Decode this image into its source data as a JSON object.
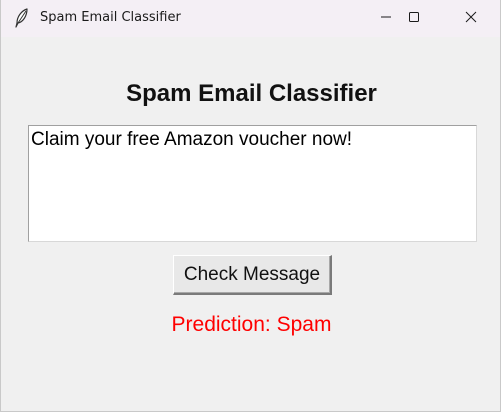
{
  "window": {
    "title": "Spam Email Classifier",
    "icons": {
      "app": "feather-icon",
      "minimize": "minimize-icon",
      "maximize": "maximize-icon",
      "close": "close-icon"
    }
  },
  "main": {
    "heading": "Spam Email Classifier",
    "message_text": "Claim your free Amazon voucher now!",
    "check_button_label": "Check Message",
    "prediction_text": "Prediction: Spam"
  },
  "colors": {
    "background": "#f0f0f0",
    "titlebar": "#f4eff5",
    "prediction": "#ff0000",
    "input_background": "#ffffff"
  }
}
